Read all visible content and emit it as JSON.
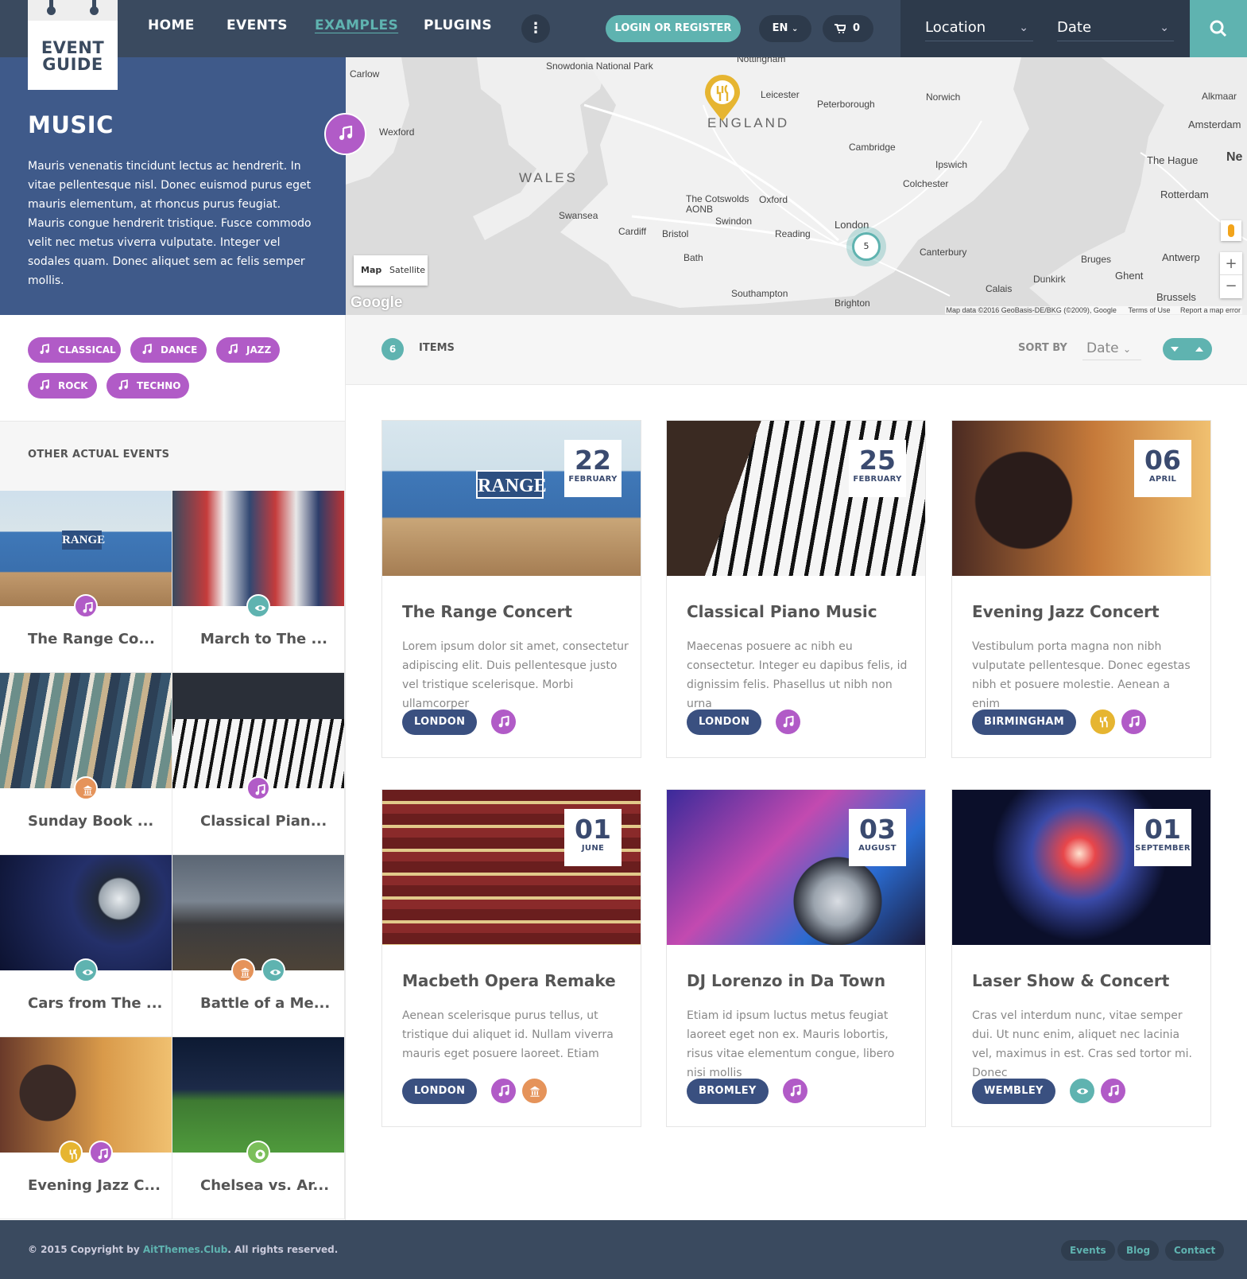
{
  "colors": {
    "accent": "#5fb3b0",
    "music": "#b15bc7",
    "food": "#e6b531",
    "museum": "#e5935a",
    "sights": "#5fb3b0",
    "sport": "#7bbf5a",
    "navy": "#3a4a5f",
    "hero": "#3f5a8a",
    "location_badge": "#3a5080"
  },
  "logo": {
    "line1": "EVENT",
    "line2": "GUIDE"
  },
  "nav": {
    "items": [
      "HOME",
      "EVENTS",
      "EXAMPLES",
      "PLUGINS"
    ],
    "active": "EXAMPLES",
    "more_icon": "vertical-dots-icon"
  },
  "header": {
    "login": "LOGIN OR REGISTER",
    "language": "EN",
    "cart_count": "0"
  },
  "filters": {
    "location": "Location",
    "date": "Date"
  },
  "hero": {
    "title": "MUSIC",
    "text": "Mauris venenatis tincidunt lectus ac hendrerit. In vitae pellentesque nisl. Donec euismod purus eget mauris elementum, at rhoncus purus feugiat. Mauris congue hendrerit tristique. Fusce commodo velit nec metus viverra vulputate. Integer vel sodales quam. Donec aliquet sem ac felis semper mollis."
  },
  "map": {
    "toggle_map": "Map",
    "toggle_satellite": "Satellite",
    "cluster_count": "5",
    "places": [
      "Snowdonia National Park",
      "Nottingham",
      "Leicester",
      "Peterborough",
      "Norwich",
      "ENGLAND",
      "WALES",
      "Cambridge",
      "Ipswich",
      "Colchester",
      "The Cotswolds AONB",
      "Oxford",
      "Swansea",
      "Cardiff",
      "Bristol",
      "Bath",
      "Swindon",
      "Reading",
      "London",
      "Canterbury",
      "Southampton",
      "Brighton",
      "Carlow",
      "Wexford",
      "Alkmaar",
      "Amsterdam",
      "The Hague",
      "Rotterdam",
      "Antwerp",
      "Bruges",
      "Ghent",
      "Dunkirk",
      "Calais",
      "Brussels",
      "Ne"
    ],
    "attribution": "Map data ©2016 GeoBasis-DE/BKG (©2009), Google",
    "terms": "Terms of Use",
    "report": "Report a map error",
    "google": "Google"
  },
  "tags": [
    "CLASSICAL",
    "DANCE",
    "JAZZ",
    "ROCK",
    "TECHNO"
  ],
  "sidebar": {
    "title": "OTHER ACTUAL EVENTS",
    "events": [
      {
        "title": "The Range Co...",
        "cats": [
          "music"
        ]
      },
      {
        "title": "March to The ...",
        "cats": [
          "sights"
        ]
      },
      {
        "title": "Sunday Book ...",
        "cats": [
          "museum"
        ]
      },
      {
        "title": "Classical Pian...",
        "cats": [
          "music"
        ]
      },
      {
        "title": "Cars from The ...",
        "cats": [
          "sights"
        ]
      },
      {
        "title": "Battle of a Me...",
        "cats": [
          "museum",
          "sights"
        ]
      },
      {
        "title": "Evening Jazz C...",
        "cats": [
          "food",
          "music"
        ]
      },
      {
        "title": "Chelsea vs. Ar...",
        "cats": [
          "sport"
        ]
      }
    ]
  },
  "list": {
    "count": "6",
    "items_label": "ITEMS",
    "sort_label": "SORT BY",
    "sort_value": "Date"
  },
  "cards": [
    {
      "day": "22",
      "month": "FEBRUARY",
      "title": "The Range Concert",
      "text": "Lorem ipsum dolor sit amet, consectetur adipiscing elit. Duis pellentesque justo vel tristique scelerisque. Morbi ullamcorper",
      "location": "LONDON",
      "cats": [
        "music"
      ]
    },
    {
      "day": "25",
      "month": "FEBRUARY",
      "title": "Classical Piano Music",
      "text": "Maecenas posuere ac nibh eu consectetur. Integer eu dapibus felis, id dignissim felis. Phasellus ut nibh non urna",
      "location": "LONDON",
      "cats": [
        "music"
      ]
    },
    {
      "day": "06",
      "month": "APRIL",
      "title": "Evening Jazz Concert",
      "text": "Vestibulum porta magna non nibh vulputate pellentesque. Donec egestas nibh et posuere molestie. Aenean a enim",
      "location": "BIRMINGHAM",
      "cats": [
        "food",
        "music"
      ]
    },
    {
      "day": "01",
      "month": "JUNE",
      "title": "Macbeth Opera Remake",
      "text": "Aenean scelerisque purus tellus, ut tristique dui aliquet id. Nullam viverra mauris eget posuere laoreet. Etiam",
      "location": "LONDON",
      "cats": [
        "music",
        "museum"
      ]
    },
    {
      "day": "03",
      "month": "AUGUST",
      "title": "DJ Lorenzo in Da Town",
      "text": "Etiam id ipsum luctus metus feugiat laoreet eget non ex. Mauris lobortis, risus vitae elementum congue, libero nisi mollis",
      "location": "BROMLEY",
      "cats": [
        "music"
      ]
    },
    {
      "day": "01",
      "month": "SEPTEMBER",
      "title": "Laser Show & Concert",
      "text": "Cras vel interdum nunc, vitae semper dui. Ut nunc enim, aliquet nec lacinia vel, maximus in est. Cras sed tortor mi. Donec",
      "location": "WEMBLEY",
      "cats": [
        "sights",
        "music"
      ]
    }
  ],
  "footer": {
    "copy_prefix": "© 2015 Copyright by ",
    "brand": "AitThemes.Club",
    "copy_suffix": ". All rights reserved.",
    "links": [
      "Events",
      "Blog",
      "Contact"
    ]
  }
}
